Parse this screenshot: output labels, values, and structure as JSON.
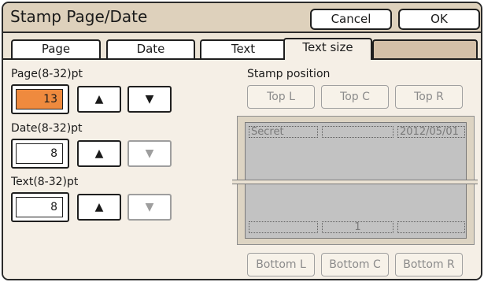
{
  "dialog": {
    "title": "Stamp Page/Date",
    "cancel_label": "Cancel",
    "ok_label": "OK"
  },
  "tabs": [
    {
      "label": "Page",
      "active": false
    },
    {
      "label": "Date",
      "active": false
    },
    {
      "label": "Text",
      "active": false
    },
    {
      "label": "Text size",
      "active": true
    }
  ],
  "size_fields": {
    "page": {
      "label": "Page(8-32)pt",
      "value": "13",
      "up": "▲",
      "down": "▼",
      "down_enabled": true
    },
    "date": {
      "label": "Date(8-32)pt",
      "value": "8",
      "up": "▲",
      "down": "▼",
      "down_enabled": false
    },
    "text": {
      "label": "Text(8-32)pt",
      "value": "8",
      "up": "▲",
      "down": "▼",
      "down_enabled": false
    }
  },
  "stamp_position": {
    "label": "Stamp position",
    "top_buttons": [
      "Top L",
      "Top C",
      "Top R"
    ],
    "bottom_buttons": [
      "Bottom L",
      "Bottom C",
      "Bottom R"
    ]
  },
  "preview": {
    "top_left": "Secret",
    "top_center": "",
    "top_right": "2012/05/01",
    "bottom_left": "",
    "bottom_center": "1",
    "bottom_right": ""
  },
  "colors": {
    "frame_bg": "#ece4d6",
    "content_bg": "#f5efe6",
    "active_value": "#ef8a3e",
    "tab_filler": "#d4c0a8",
    "preview_paper": "#c2c2c2"
  }
}
